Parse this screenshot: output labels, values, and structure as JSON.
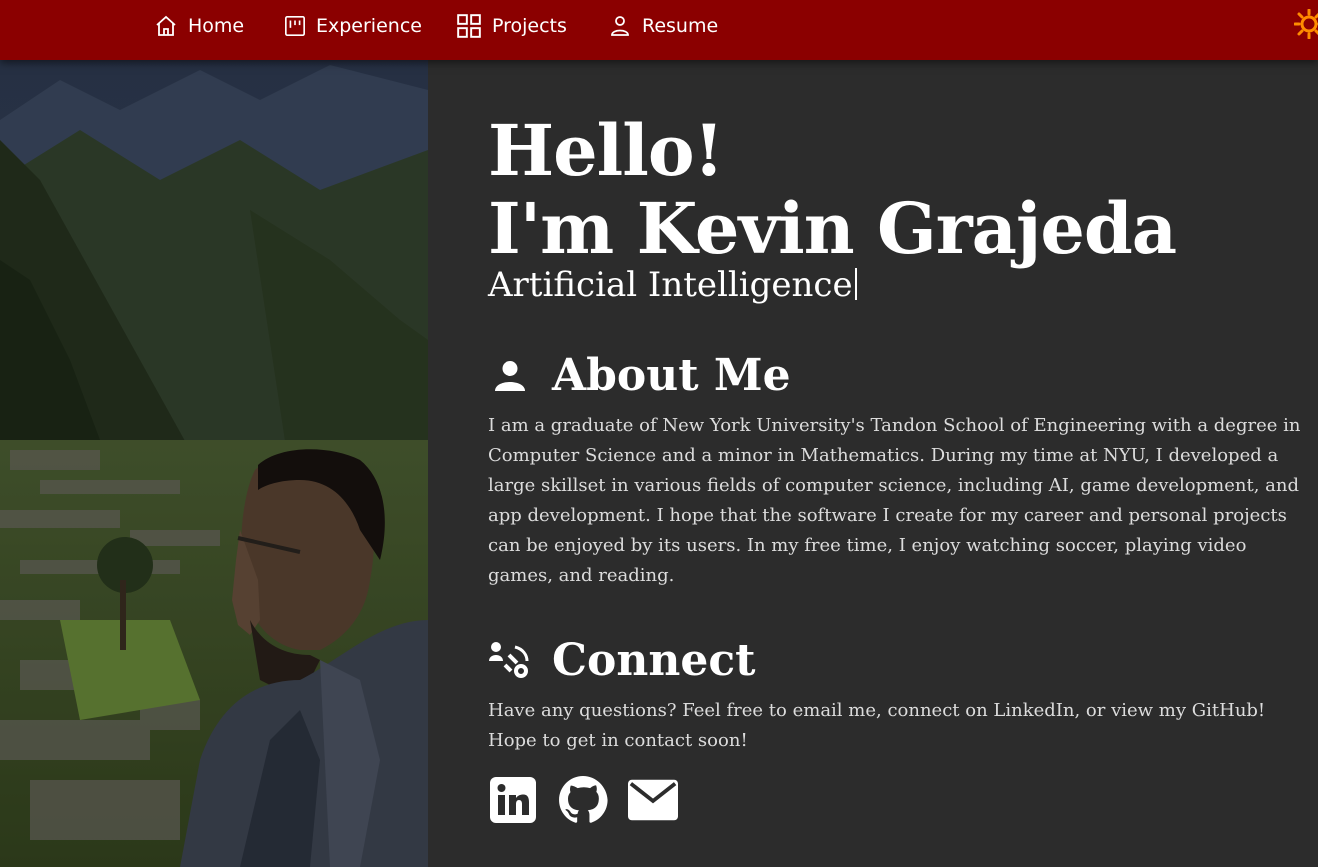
{
  "nav": {
    "items": [
      {
        "label": "Home",
        "icon": "home-icon"
      },
      {
        "label": "Experience",
        "icon": "kanban-icon"
      },
      {
        "label": "Projects",
        "icon": "grid-icon"
      },
      {
        "label": "Resume",
        "icon": "person-icon"
      }
    ],
    "theme_icon": "sun-icon"
  },
  "hero": {
    "line1": "Hello!",
    "line2": "I'm Kevin Grajeda",
    "typed": "Artificial Intelligence"
  },
  "about": {
    "title": "About Me",
    "icon": "person-icon",
    "text": "I am a graduate of New York University's Tandon School of Engineering with a degree in Computer Science and a minor in Mathematics. During my time at NYU, I developed a large skillset in various fields of computer science, including AI, game development, and app development. I hope that the software I create for my career and personal projects can be enjoyed by its users. In my free time, I enjoy watching soccer, playing video games, and reading."
  },
  "connect": {
    "title": "Connect",
    "icon": "connect-icon",
    "text": "Have any questions? Feel free to email me, connect on LinkedIn, or view my GitHub! Hope to get in contact soon!",
    "links": [
      {
        "icon": "linkedin-icon"
      },
      {
        "icon": "github-icon"
      },
      {
        "icon": "email-icon"
      }
    ]
  },
  "colors": {
    "navbar": "#8b0000",
    "background": "#2c2c2c",
    "text": "#ffffff",
    "muted_text": "#dcdcdc",
    "sun": "#ff8c00"
  }
}
